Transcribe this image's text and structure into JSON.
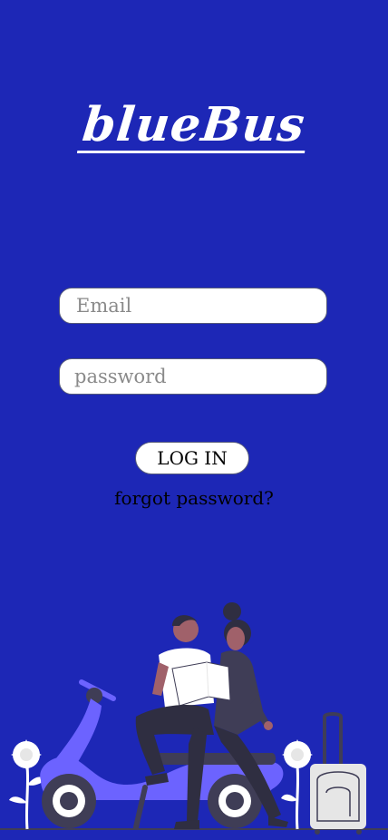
{
  "brand": {
    "logo_text": "blueBus"
  },
  "login_form": {
    "email_placeholder": "Email",
    "email_value": "",
    "password_placeholder": "password",
    "password_value": "",
    "login_label": "LOG IN",
    "forgot_label": "forgot password?"
  },
  "colors": {
    "background": "#1d27b6",
    "scooter": "#6c63ff",
    "field_bg": "#ffffff"
  }
}
